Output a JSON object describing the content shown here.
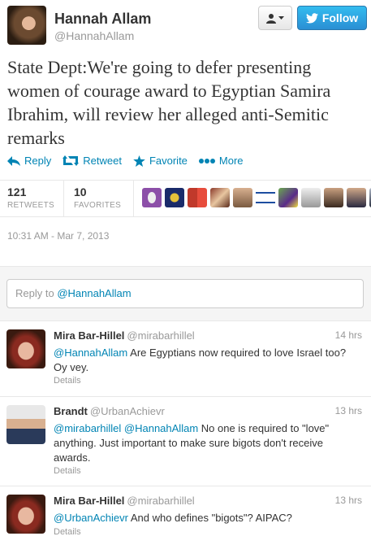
{
  "tweet": {
    "author_name": "Hannah Allam",
    "author_handle": "@HannahAllam",
    "follow_label": "Follow",
    "text": "State Dept:We're going to defer presenting women of courage award to Egyptian Samira Ibrahim, will review her alleged anti-Semitic remarks",
    "actions": {
      "reply": "Reply",
      "retweet": "Retweet",
      "favorite": "Favorite",
      "more": "More"
    },
    "stats": {
      "retweets_count": "121",
      "retweets_label": "RETWEETS",
      "favorites_count": "10",
      "favorites_label": "FAVORITES"
    },
    "timestamp": "10:31 AM - Mar 7, 2013"
  },
  "reply_box": {
    "prefix": "Reply to ",
    "mention": "@HannahAllam"
  },
  "replies": [
    {
      "name": "Mira Bar-Hillel",
      "handle": "@mirabarhillel",
      "time": "14 hrs",
      "mention1": "@HannahAllam",
      "text": " Are Egyptians now required to love Israel too? Oy vey.",
      "details": "Details"
    },
    {
      "name": "Brandt",
      "handle": "@UrbanAchievr",
      "time": "13 hrs",
      "mention1": "@mirabarhillel",
      "mention2": "@HannahAllam",
      "text": " No one is required to \"love\" anything. Just important to make sure bigots don't receive awards.",
      "details": "Details"
    },
    {
      "name": "Mira Bar-Hillel",
      "handle": "@mirabarhillel",
      "time": "13 hrs",
      "mention1": "@UrbanAchievr",
      "text": " And who defines \"bigots\"? AIPAC?",
      "details": "Details"
    }
  ],
  "colors": {
    "link": "#0084b4",
    "follow_button": "#2a8fd4"
  }
}
